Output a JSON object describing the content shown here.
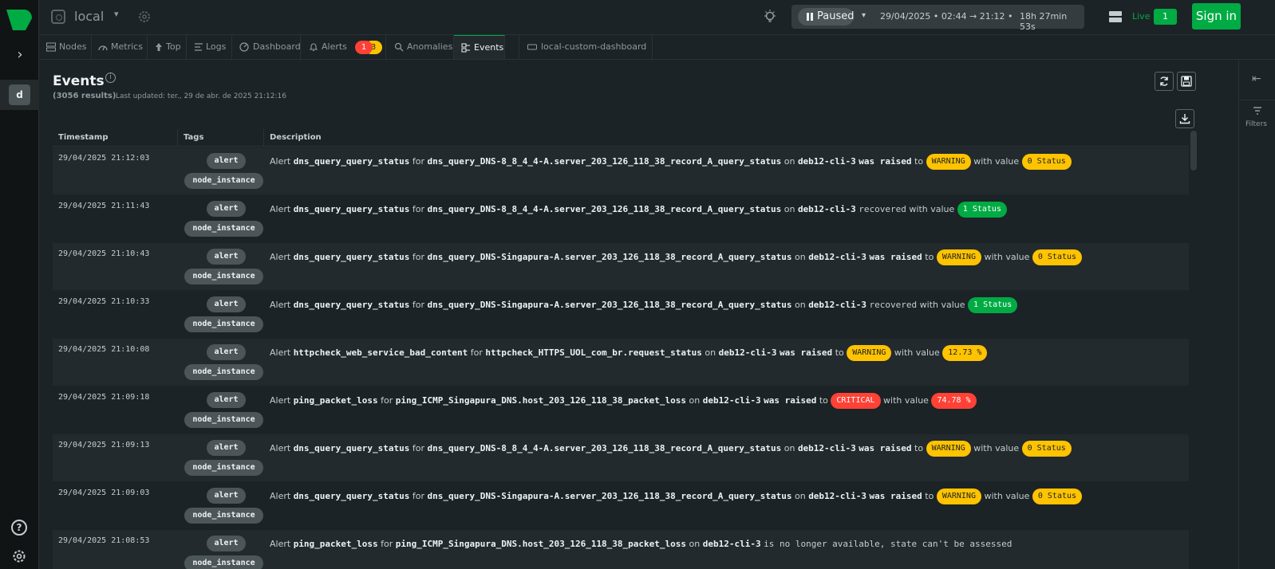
{
  "topbar": {
    "space_name": "local",
    "paused_label": "Paused",
    "time_range": "29/04/2025 • 02:44 → 21:12 •",
    "duration": "18h 27min 53s",
    "live_label": "Live",
    "live_count": "1",
    "signin_label": "Sign in"
  },
  "rail": {
    "space_initial": "d",
    "help_label": "?"
  },
  "tabs": [
    {
      "label": "Nodes",
      "icon": "nodes-icon"
    },
    {
      "label": "Metrics",
      "icon": "metrics-icon"
    },
    {
      "label": "Top",
      "icon": "top-icon"
    },
    {
      "label": "Logs",
      "icon": "logs-icon"
    },
    {
      "label": "Dashboard",
      "icon": "dashboard-icon"
    },
    {
      "label": "Alerts",
      "icon": "bell-icon",
      "critical_count": "1",
      "warning_count": "3"
    },
    {
      "label": "Anomalies",
      "icon": "anomalies-icon"
    },
    {
      "label": "Events",
      "icon": "events-icon",
      "active": true
    },
    {
      "label": "local-custom-dashboard",
      "icon": "custom-dashboard-icon"
    }
  ],
  "page": {
    "title": "Events",
    "results": "(3056 results)",
    "last_updated": "Last updated: ter., 29 de abr. de 2025 21:12:16",
    "filters_label": "Filters"
  },
  "table": {
    "columns": [
      "Timestamp",
      "Tags",
      "Description"
    ],
    "rows": [
      {
        "timestamp": "29/04/2025 21:12:03",
        "tags": [
          "alert",
          "node_instance"
        ],
        "a": "Alert",
        "metric": "dns_query_query_status",
        "f": "for",
        "chart": "dns_query_DNS-8_8_4_4-A.server_203_126_118_38_record_A_query_status",
        "o": "on",
        "node": "deb12-cli-3",
        "action": "was raised",
        "t": "to",
        "status": "WARNING",
        "wv": "with value",
        "value": "0 Status"
      },
      {
        "timestamp": "29/04/2025 21:11:43",
        "tags": [
          "alert",
          "node_instance"
        ],
        "a": "Alert",
        "metric": "dns_query_query_status",
        "f": "for",
        "chart": "dns_query_DNS-8_8_4_4-A.server_203_126_118_38_record_A_query_status",
        "o": "on",
        "node": "deb12-cli-3",
        "action": "recovered",
        "t": "",
        "status": "",
        "wv": "with value",
        "value": "1 Status"
      },
      {
        "timestamp": "29/04/2025 21:10:43",
        "tags": [
          "alert",
          "node_instance"
        ],
        "a": "Alert",
        "metric": "dns_query_query_status",
        "f": "for",
        "chart": "dns_query_DNS-Singapura-A.server_203_126_118_38_record_A_query_status",
        "o": "on",
        "node": "deb12-cli-3",
        "action": "was raised",
        "t": "to",
        "status": "WARNING",
        "wv": "with value",
        "value": "0 Status"
      },
      {
        "timestamp": "29/04/2025 21:10:33",
        "tags": [
          "alert",
          "node_instance"
        ],
        "a": "Alert",
        "metric": "dns_query_query_status",
        "f": "for",
        "chart": "dns_query_DNS-Singapura-A.server_203_126_118_38_record_A_query_status",
        "o": "on",
        "node": "deb12-cli-3",
        "action": "recovered",
        "t": "",
        "status": "",
        "wv": "with value",
        "value": "1 Status"
      },
      {
        "timestamp": "29/04/2025 21:10:08",
        "tags": [
          "alert",
          "node_instance"
        ],
        "a": "Alert",
        "metric": "httpcheck_web_service_bad_content",
        "f": "for",
        "chart": "httpcheck_HTTPS_UOL_com_br.request_status",
        "o": "on",
        "node": "deb12-cli-3",
        "action": "was raised",
        "t": "to",
        "status": "WARNING",
        "wv": "with value",
        "value": "12.73 %"
      },
      {
        "timestamp": "29/04/2025 21:09:18",
        "tags": [
          "alert",
          "node_instance"
        ],
        "a": "Alert",
        "metric": "ping_packet_loss",
        "f": "for",
        "chart": "ping_ICMP_Singapura_DNS.host_203_126_118_38_packet_loss",
        "o": "on",
        "node": "deb12-cli-3",
        "action": "was raised",
        "t": "to",
        "status": "CRITICAL",
        "wv": "with value",
        "value": "74.78 %"
      },
      {
        "timestamp": "29/04/2025 21:09:13",
        "tags": [
          "alert",
          "node_instance"
        ],
        "a": "Alert",
        "metric": "dns_query_query_status",
        "f": "for",
        "chart": "dns_query_DNS-8_8_4_4-A.server_203_126_118_38_record_A_query_status",
        "o": "on",
        "node": "deb12-cli-3",
        "action": "was raised",
        "t": "to",
        "status": "WARNING",
        "wv": "with value",
        "value": "0 Status"
      },
      {
        "timestamp": "29/04/2025 21:09:03",
        "tags": [
          "alert",
          "node_instance"
        ],
        "a": "Alert",
        "metric": "dns_query_query_status",
        "f": "for",
        "chart": "dns_query_DNS-Singapura-A.server_203_126_118_38_record_A_query_status",
        "o": "on",
        "node": "deb12-cli-3",
        "action": "was raised",
        "t": "to",
        "status": "WARNING",
        "wv": "with value",
        "value": "0 Status"
      },
      {
        "timestamp": "29/04/2025 21:08:53",
        "tags": [
          "alert",
          "node_instance"
        ],
        "a": "Alert",
        "metric": "ping_packet_loss",
        "f": "for",
        "chart": "ping_ICMP_Singapura_DNS.host_203_126_118_38_packet_loss",
        "o": "on",
        "node": "deb12-cli-3",
        "action": "is no longer available, state can't be assessed",
        "t": "",
        "status": "",
        "wv": "",
        "value": ""
      }
    ]
  },
  "colors": {
    "accent": "#00ab44",
    "warning": "#ffc300",
    "critical": "#ff4136",
    "background": "#1c2326"
  }
}
